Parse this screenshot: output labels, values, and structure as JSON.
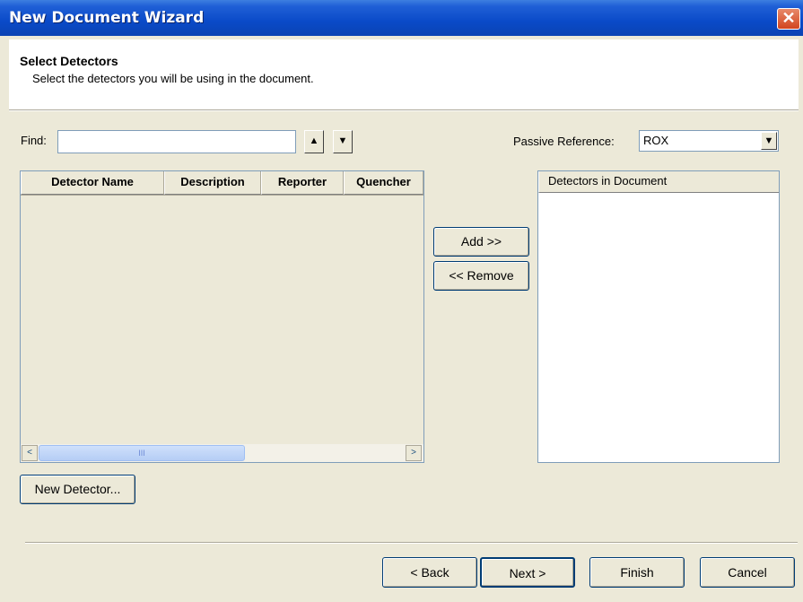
{
  "window": {
    "title": "New Document Wizard",
    "close_glyph": "✕"
  },
  "header": {
    "title": "Select Detectors",
    "subtitle": "Select the detectors you will be using in the document."
  },
  "find": {
    "label": "Find:",
    "value": "",
    "up_glyph": "▲",
    "down_glyph": "▼"
  },
  "passive_reference": {
    "label": "Passive Reference:",
    "value": "ROX",
    "arrow_glyph": "▼"
  },
  "detector_table": {
    "columns": [
      "Detector Name",
      "Description",
      "Reporter",
      "Quencher"
    ],
    "rows": [],
    "scroll_left_glyph": "<",
    "scroll_right_glyph": ">",
    "thumb_grip": "III"
  },
  "buttons": {
    "add": "Add >>",
    "remove": "<< Remove",
    "new_detector": "New Detector...",
    "back": "< Back",
    "next": "Next >",
    "finish": "Finish",
    "cancel": "Cancel"
  },
  "detectors_in_document": {
    "header": "Detectors in Document",
    "items": []
  },
  "colors": {
    "title_bar": "#0a4ac8",
    "background": "#ece9d8",
    "close_button": "#d2441f"
  }
}
